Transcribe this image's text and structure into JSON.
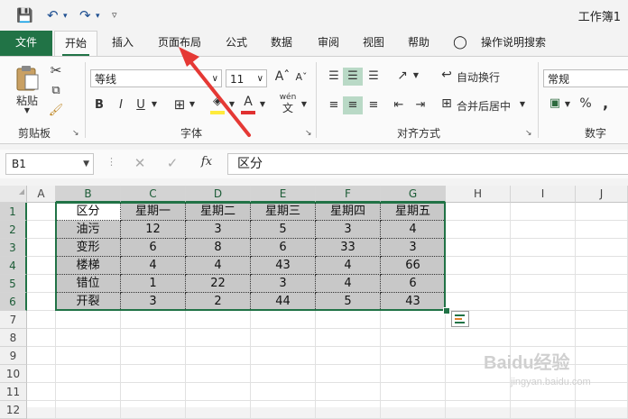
{
  "window": {
    "title": "工作簿1"
  },
  "tabs": [
    "文件",
    "开始",
    "插入",
    "页面布局",
    "公式",
    "数据",
    "审阅",
    "视图",
    "帮助",
    "操作说明搜索"
  ],
  "ribbon": {
    "paste_label": "粘贴",
    "font_name": "等线",
    "font_size": "11",
    "bold": "B",
    "italic": "I",
    "underline": "U",
    "font_color_glyph": "A",
    "wen": "wén",
    "wen_char": "文",
    "wrap_text": "自动换行",
    "merge_center": "合并后居中",
    "number_format": "常规",
    "percent": "%",
    "comma": ",",
    "groups": {
      "clipboard": "剪贴板",
      "font": "字体",
      "alignment": "对齐方式",
      "number": "数字"
    }
  },
  "formula_bar": {
    "name_box": "B1",
    "fx": "fx",
    "content": "区分"
  },
  "grid": {
    "columns": [
      "A",
      "B",
      "C",
      "D",
      "E",
      "F",
      "G",
      "H",
      "I",
      "J"
    ],
    "rows": [
      "1",
      "2",
      "3",
      "4",
      "5",
      "6",
      "7",
      "8",
      "9",
      "10",
      "11",
      "12"
    ],
    "header": [
      "区分",
      "星期一",
      "星期二",
      "星期三",
      "星期四",
      "星期五"
    ],
    "data": [
      [
        "油污",
        "12",
        "3",
        "5",
        "3",
        "4"
      ],
      [
        "变形",
        "6",
        "8",
        "6",
        "33",
        "3"
      ],
      [
        "楼梯",
        "4",
        "4",
        "43",
        "4",
        "66"
      ],
      [
        "错位",
        "1",
        "22",
        "3",
        "4",
        "6"
      ],
      [
        "开裂",
        "3",
        "2",
        "44",
        "5",
        "43"
      ]
    ]
  },
  "colors": {
    "excel_green": "#217346",
    "arrow_red": "#e53935",
    "selection_gray": "#c8c8c8"
  },
  "watermark": {
    "line1": "Baidu经验",
    "line2": "jingyan.baidu.com"
  }
}
